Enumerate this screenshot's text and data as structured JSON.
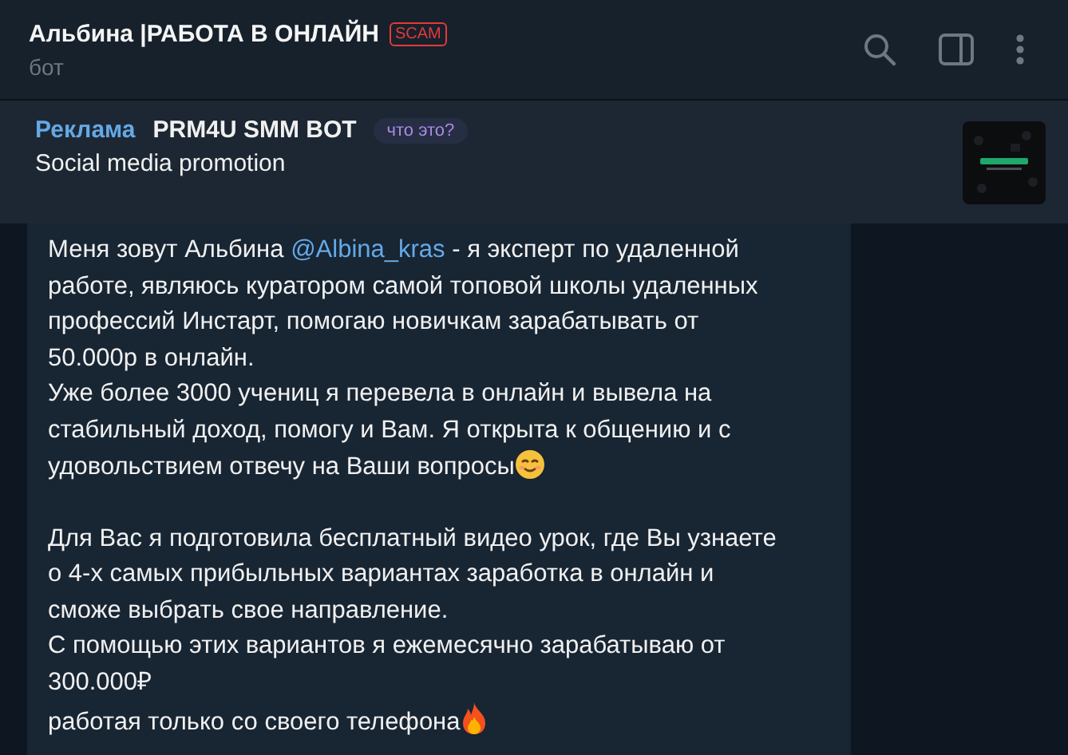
{
  "header": {
    "title": "Альбина |РАБОТА В ОНЛАЙН",
    "badge": "SCAM",
    "subtitle": "бот"
  },
  "sponsored": {
    "label": "Реклама",
    "name": "PRM4U SMM BOT",
    "hint": "что это?",
    "text": "Social media promotion"
  },
  "message": {
    "paragraphs": [
      {
        "before": "Меня зовут Альбина ",
        "link": "@Albina_kras",
        "after": " - я эксперт по удаленной\nработе, являюсь куратором самой топовой школы удаленных\nпрофессий Инстарт, помогаю новичкам зарабатывать от\n50.000р в онлайн.\nУже более 3000 учениц я перевела в онлайн и вывела на\nстабильный доход, помогу и Вам. Я открыта к общению и с\nудовольствием отвечу на Ваши вопросы",
        "trailing_icon": {
          "kind": "smiley"
        }
      },
      {
        "before": "Для Вас я подготовила бесплатный видео урок, где Вы узнаете\nо 4-х самых прибыльных вариантах заработка в онлайн и\nсможе выбрать свое направление.\nС помощью этих вариантов я ежемесячно зарабатываю от\n300.000₽\nработая только со своего телефона",
        "trailing_icon": {
          "kind": "fire"
        }
      }
    ]
  }
}
